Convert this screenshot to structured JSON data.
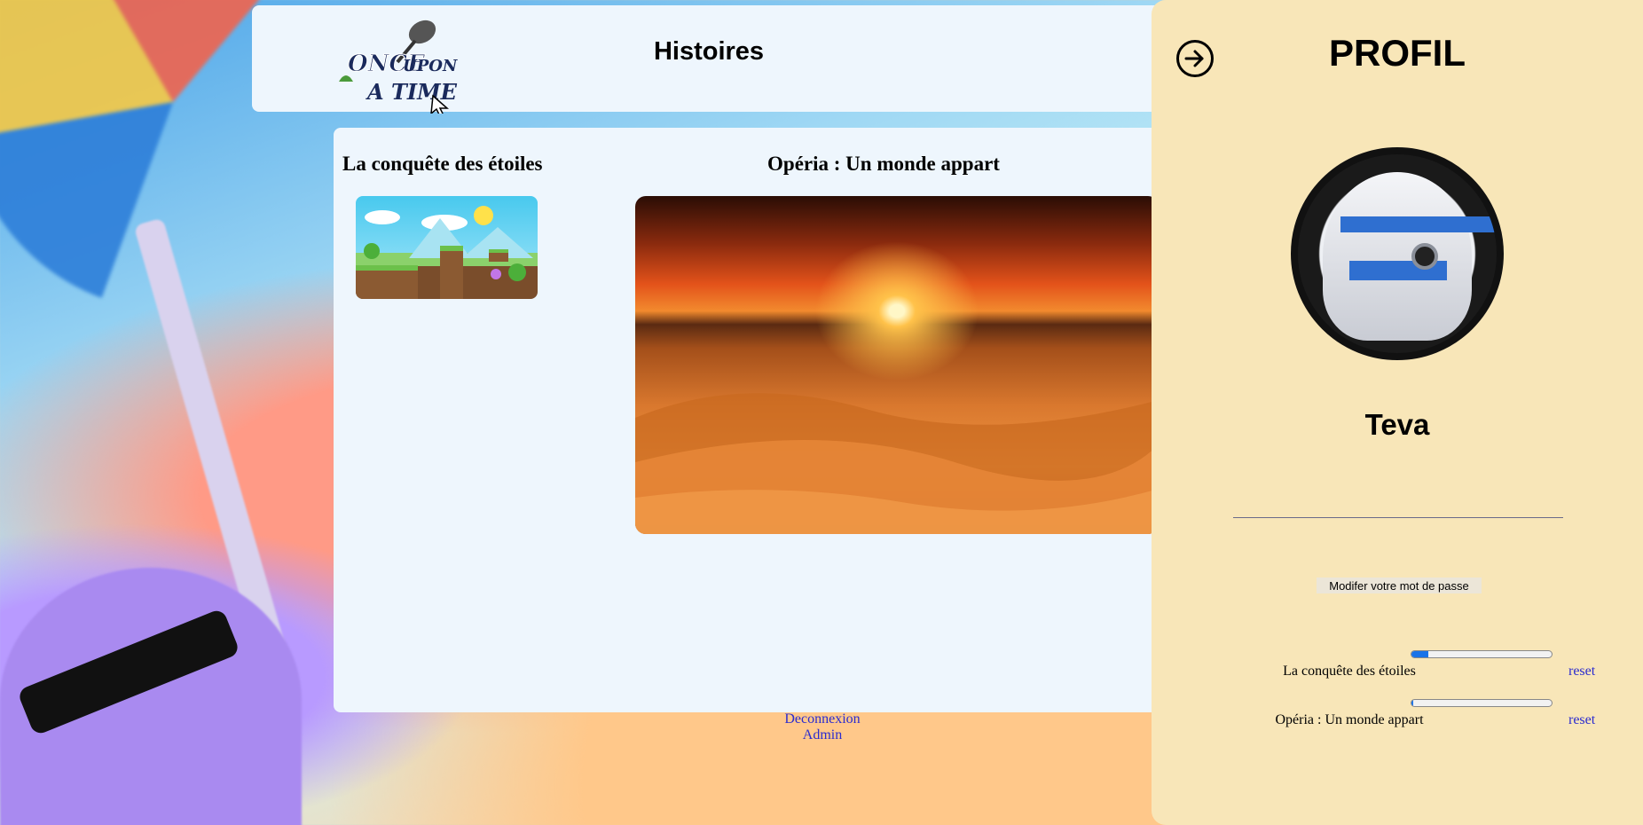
{
  "header": {
    "logo_text": "Once Upon A Time",
    "title": "Histoires"
  },
  "stories": [
    {
      "title": "La conquête des étoiles"
    },
    {
      "title": "Opéria : Un monde appart"
    }
  ],
  "profile": {
    "title": "PROFIL",
    "username": "Teva",
    "change_password_label": "Modifer votre mot de passe",
    "progress": [
      {
        "label": "La conquête des étoiles",
        "value": 0.12,
        "reset_label": "reset"
      },
      {
        "label": "Opéria : Un monde appart",
        "value": 0.01,
        "reset_label": "reset"
      }
    ]
  },
  "footer": {
    "logout_label": "Deconnexion",
    "admin_label": "Admin"
  },
  "colors": {
    "sidebar_bg": "#f8e6b8",
    "panel_bg": "#eef6fd",
    "link": "#2b2bcf",
    "progress_fill": "#1a73e8"
  }
}
